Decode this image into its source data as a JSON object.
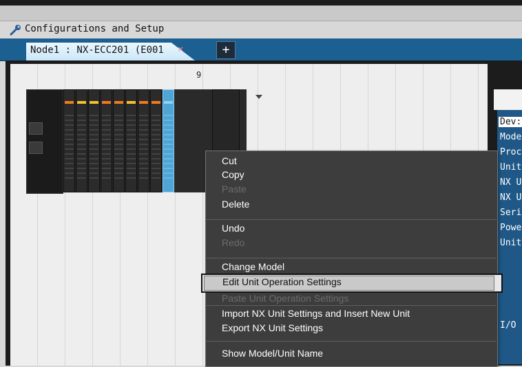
{
  "window": {
    "title": "Configurations and Setup",
    "tab_label": "Node1 : NX-ECC201 (E001",
    "tab_close": "×",
    "add_tab": "+"
  },
  "canvas": {
    "slot_number": "9"
  },
  "units": {
    "slot_count": 9
  },
  "right_panel": {
    "items": [
      "Dev:",
      "Mode",
      "Proc",
      "Unit",
      "NX U",
      "NX U",
      "Seri",
      "Powe",
      "Unit"
    ],
    "io_label": "I/O"
  },
  "context_menu": {
    "items": [
      {
        "label": "Cut",
        "enabled": true
      },
      {
        "label": "Copy",
        "enabled": true
      },
      {
        "label": "Paste",
        "enabled": false
      },
      {
        "label": "Delete",
        "enabled": true
      },
      {
        "label": "Undo",
        "enabled": true
      },
      {
        "label": "Redo",
        "enabled": false
      },
      {
        "label": "Change Model",
        "enabled": true
      },
      {
        "label": "Edit Unit Operation Settings",
        "enabled": true,
        "highlighted": true
      },
      {
        "label": "Paste Unit Operation Settings",
        "enabled": false
      },
      {
        "label": "Import NX Unit Settings and Insert New Unit",
        "enabled": true
      },
      {
        "label": "Export NX Unit Settings",
        "enabled": true
      },
      {
        "label": "Show Model/Unit Name",
        "enabled": true
      }
    ]
  },
  "colors": {
    "tab_bar": "#1c5f91",
    "menu_bg": "#3d3d3d",
    "selected_unit": "#4ea5d6",
    "orange_indicator": "#f07a1e",
    "yellow_indicator": "#f2c12e"
  }
}
